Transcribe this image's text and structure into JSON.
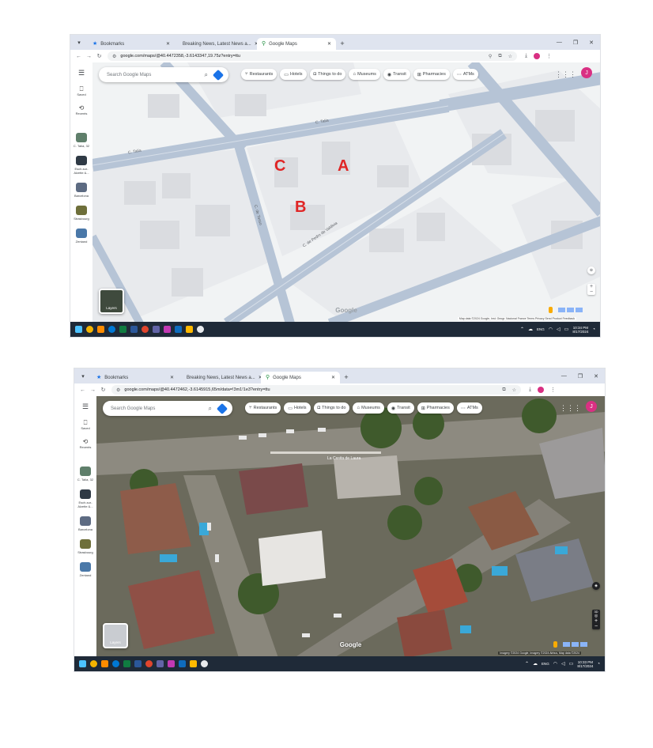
{
  "screens": [
    {
      "id": "map-view",
      "tabs": [
        {
          "label": "Bookmarks",
          "icon": "star-icon"
        },
        {
          "label": "Breaking News, Latest News a...",
          "icon": "news-favicon"
        },
        {
          "label": "Google Maps",
          "icon": "maps-pin-icon"
        }
      ],
      "url": "google.com/maps/@40.4472358,-3.6143347,19.75z?entry=ttu",
      "search_placeholder": "Search Google Maps",
      "chips": [
        "Restaurants",
        "Hotels",
        "Things to do",
        "Museums",
        "Transit",
        "Pharmacies",
        "ATMs"
      ],
      "rail": [
        {
          "label": "Saved",
          "icon": "bookmark-icon"
        },
        {
          "label": "Recents",
          "icon": "history-icon"
        },
        {
          "label": "C. Talía, 32",
          "icon": "place-thumb"
        },
        {
          "label": "Esch-sur-Alzette &...",
          "icon": "place-thumb"
        },
        {
          "label": "Barcelona",
          "icon": "place-thumb"
        },
        {
          "label": "Strasbourg",
          "icon": "place-thumb"
        },
        {
          "label": "Zentand",
          "icon": "place-thumb"
        }
      ],
      "avatar": "J",
      "layers_label": "Layers",
      "map_labels": [
        "C. Talía",
        "C. Talía",
        "C. de Tasso",
        "C. de Pedro de Valdivia"
      ],
      "markers": [
        "A",
        "B",
        "C"
      ],
      "logo": "Google",
      "attribution": "Map data ©2024 Google, Inst. Geogr. Nacional   France   Terms   Privacy   Send Product Feedback",
      "clock_time": "10:34 PM",
      "clock_date": "8/17/2024",
      "lang": "ENG"
    },
    {
      "id": "satellite-view",
      "tabs": [
        {
          "label": "Bookmarks",
          "icon": "star-icon"
        },
        {
          "label": "Breaking News, Latest News a...",
          "icon": "news-favicon"
        },
        {
          "label": "Google Maps",
          "icon": "maps-pin-icon"
        }
      ],
      "url": "google.com/maps/@40.4472462,-3.6145915,65m/data=!3m1!1e3?entry=ttu",
      "search_placeholder": "Search Google Maps",
      "chips": [
        "Restaurants",
        "Hotels",
        "Things to do",
        "Museums",
        "Transit",
        "Pharmacies",
        "ATMs"
      ],
      "rail": [
        {
          "label": "Saved",
          "icon": "bookmark-icon"
        },
        {
          "label": "Recents",
          "icon": "history-icon"
        },
        {
          "label": "C. Talía, 32",
          "icon": "place-thumb"
        },
        {
          "label": "Esch-sur-Alzette &...",
          "icon": "place-thumb"
        },
        {
          "label": "Barcelona",
          "icon": "place-thumb"
        },
        {
          "label": "Strasbourg",
          "icon": "place-thumb"
        },
        {
          "label": "Zentand",
          "icon": "place-thumb"
        }
      ],
      "avatar": "J",
      "layers_label": "Layers",
      "map_labels": [
        "La Casita de Laura"
      ],
      "logo": "Google",
      "attribution": "Imagery ©2024 Google, Imagery ©2024 Airbus, Map data ©2024",
      "clock_time": "10:33 PM",
      "clock_date": "8/17/2024",
      "lang": "ENG"
    }
  ],
  "colors": {
    "accent": "#1a73e8",
    "marker_red": "#e02525",
    "taskbar": "#1f2a38",
    "profile": "#d93083"
  }
}
